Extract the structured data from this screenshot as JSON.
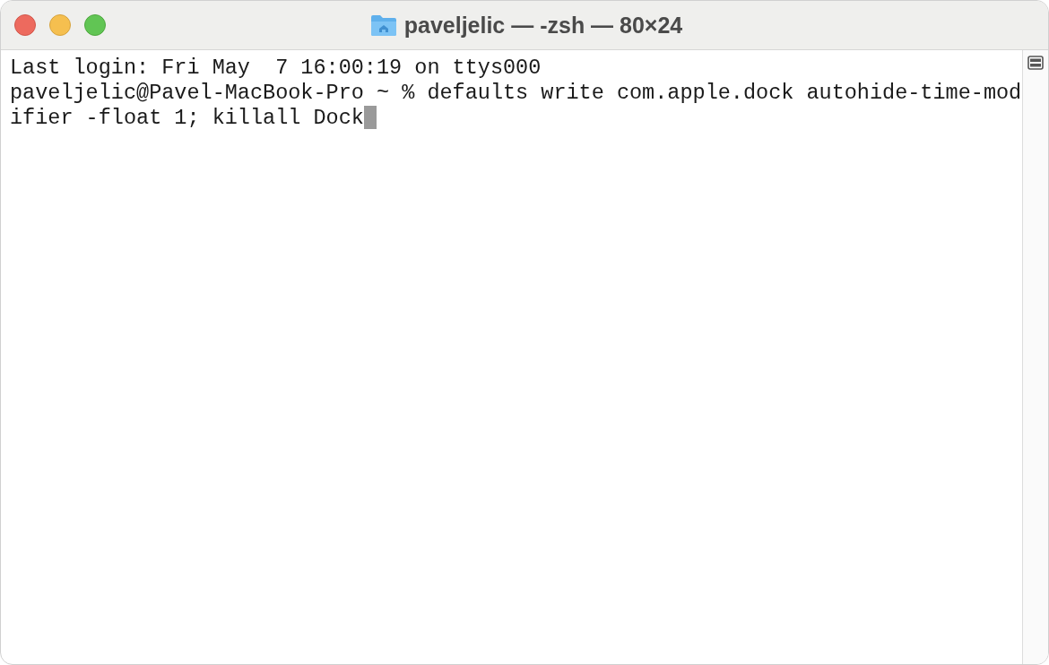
{
  "window": {
    "title": "paveljelic — -zsh — 80×24"
  },
  "terminal": {
    "lines": [
      "Last login: Fri May  7 16:00:19 on ttys000",
      "paveljelic@Pavel-MacBook-Pro ~ % defaults write com.apple.dock autohide-time-mod",
      "ifier -float 1; killall Dock"
    ]
  }
}
